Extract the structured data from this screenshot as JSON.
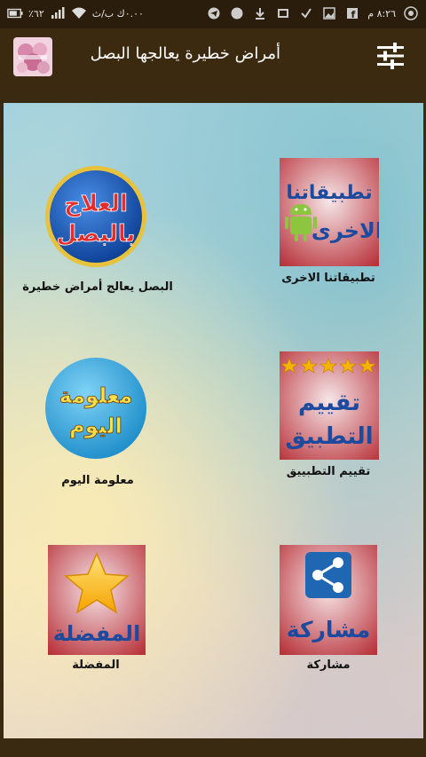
{
  "status_bar": {
    "time": "٨:٢٦ م",
    "battery_text": "٪٦٢",
    "network_text": "٠.٠٠ك ب/ث"
  },
  "app_bar": {
    "title": "أمراض خطيرة يعالجها البصل"
  },
  "tiles": {
    "onion_treatment": {
      "label": "البصل يعالج أمراض خطيرة",
      "image_line1": "العلاج",
      "image_line2": "بالبصل"
    },
    "other_apps": {
      "label": "تطبيقاتنا الاخرى",
      "image_line1": "تطبيقاتنا",
      "image_line2": "الاخرى"
    },
    "daily_info": {
      "label": "معلومة اليوم",
      "image_line1": "معلومة",
      "image_line2": "اليوم"
    },
    "rate_app": {
      "label": "تقييم التطبييق",
      "image_line1": "تقييم",
      "image_line2": "التطبيق"
    },
    "favorites": {
      "label": "المفضلة",
      "image_line1": "المفضلة"
    },
    "share": {
      "label": "مشاركة",
      "image_line1": "مشاركة"
    }
  },
  "colors": {
    "status_bar": "#2a1d0c",
    "app_bar": "#3b2a10",
    "tile_red": "#c0392b",
    "tile_yellow_text": "#f7e04a",
    "tile_blue_circle": "#1f66b3"
  },
  "icons": [
    "filter-settings-icon",
    "whatsapp-icon",
    "facebook-icon",
    "telegram-icon",
    "download-icon",
    "check-icon",
    "wifi-icon",
    "signal-icon",
    "battery-icon",
    "android-icon",
    "share-icon",
    "star-icon"
  ]
}
